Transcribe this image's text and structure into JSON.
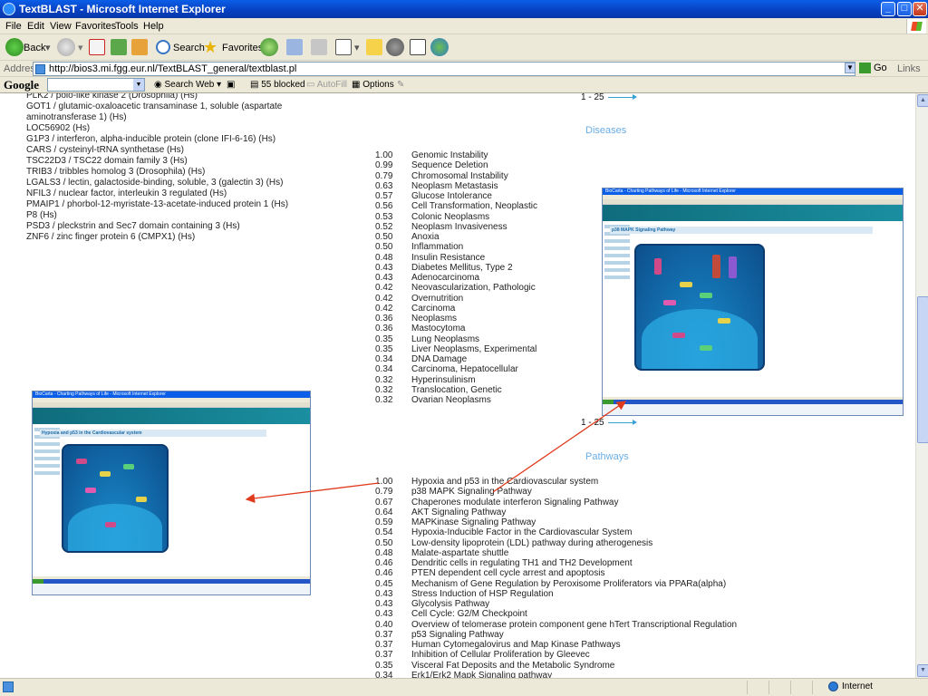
{
  "window": {
    "title": "TextBLAST - Microsoft Internet Explorer",
    "min": "_",
    "max": "□",
    "close": "✕"
  },
  "menu": [
    "File",
    "Edit",
    "View",
    "Favorites",
    "Tools",
    "Help"
  ],
  "toolbar": {
    "back": "Back",
    "search": "Search",
    "favorites": "Favorites"
  },
  "address": {
    "label": "Address",
    "url": "http://bios3.mi.fgg.eur.nl/TextBLAST_general/textblast.pl",
    "go": "Go",
    "links": "Links"
  },
  "google": {
    "logo": "Google",
    "search_web": "Search Web",
    "blocked": "55 blocked",
    "autofill": "AutoFill",
    "options": "Options"
  },
  "genes": [
    "PLK2 / polo-like kinase 2 (Drosophila) (Hs)",
    "GOT1 / glutamic-oxaloacetic transaminase 1, soluble (aspartate",
    "aminotransferase 1) (Hs)",
    "LOC56902 (Hs)",
    "G1P3 / interferon, alpha-inducible protein (clone IFI-6-16) (Hs)",
    "CARS / cysteinyl-tRNA synthetase (Hs)",
    "TSC22D3 / TSC22 domain family 3 (Hs)",
    "TRIB3 / tribbles homolog 3 (Drosophila) (Hs)",
    "LGALS3 / lectin, galactoside-binding, soluble, 3 (galectin 3) (Hs)",
    "NFIL3 / nuclear factor, interleukin 3 regulated (Hs)",
    "PMAIP1 / phorbol-12-myristate-13-acetate-induced protein 1 (Hs)",
    "P8 (Hs)",
    "PSD3 / pleckstrin and Sec7 domain containing 3 (Hs)",
    "ZNF6 / zinc finger protein 6 (CMPX1) (Hs)"
  ],
  "diseases": {
    "pager": "1 - 25",
    "title": "Diseases",
    "rows": [
      {
        "score": "1.00",
        "name": "Genomic Instability"
      },
      {
        "score": "0.99",
        "name": "Sequence Deletion"
      },
      {
        "score": "0.79",
        "name": "Chromosomal Instability"
      },
      {
        "score": "0.63",
        "name": "Neoplasm Metastasis"
      },
      {
        "score": "0.57",
        "name": "Glucose Intolerance"
      },
      {
        "score": "0.56",
        "name": "Cell Transformation, Neoplastic"
      },
      {
        "score": "0.53",
        "name": "Colonic Neoplasms"
      },
      {
        "score": "0.52",
        "name": "Neoplasm Invasiveness"
      },
      {
        "score": "0.50",
        "name": "Anoxia"
      },
      {
        "score": "0.50",
        "name": "Inflammation"
      },
      {
        "score": "0.48",
        "name": "Insulin Resistance"
      },
      {
        "score": "0.43",
        "name": "Diabetes Mellitus, Type 2"
      },
      {
        "score": "0.43",
        "name": "Adenocarcinoma"
      },
      {
        "score": "0.42",
        "name": "Neovascularization, Pathologic"
      },
      {
        "score": "0.42",
        "name": "Overnutrition"
      },
      {
        "score": "0.42",
        "name": "Carcinoma"
      },
      {
        "score": "0.36",
        "name": "Neoplasms"
      },
      {
        "score": "0.36",
        "name": "Mastocytoma"
      },
      {
        "score": "0.35",
        "name": "Lung Neoplasms"
      },
      {
        "score": "0.35",
        "name": "Liver Neoplasms, Experimental"
      },
      {
        "score": "0.34",
        "name": "DNA Damage"
      },
      {
        "score": "0.34",
        "name": "Carcinoma, Hepatocellular"
      },
      {
        "score": "0.32",
        "name": "Hyperinsulinism"
      },
      {
        "score": "0.32",
        "name": "Translocation, Genetic"
      },
      {
        "score": "0.32",
        "name": "Ovarian Neoplasms"
      }
    ]
  },
  "pathways": {
    "pager": "1 - 25",
    "title": "Pathways",
    "rows": [
      {
        "score": "1.00",
        "name": "Hypoxia and p53 in the Cardiovascular system"
      },
      {
        "score": "0.79",
        "name": "p38 MAPK Signaling Pathway"
      },
      {
        "score": "0.67",
        "name": "Chaperones modulate interferon Signaling Pathway"
      },
      {
        "score": "0.64",
        "name": "AKT Signaling Pathway"
      },
      {
        "score": "0.59",
        "name": "MAPKinase Signaling Pathway"
      },
      {
        "score": "0.54",
        "name": "Hypoxia-Inducible Factor in the Cardiovascular System"
      },
      {
        "score": "0.50",
        "name": "Low-density lipoprotein (LDL) pathway during atherogenesis"
      },
      {
        "score": "0.48",
        "name": "Malate-aspartate shuttle"
      },
      {
        "score": "0.46",
        "name": "Dendritic cells in regulating TH1 and TH2 Development"
      },
      {
        "score": "0.46",
        "name": "PTEN dependent cell cycle arrest and apoptosis"
      },
      {
        "score": "0.45",
        "name": "Mechanism of Gene Regulation by Peroxisome Proliferators via PPARa(alpha)"
      },
      {
        "score": "0.43",
        "name": "Stress Induction of HSP Regulation"
      },
      {
        "score": "0.43",
        "name": "Glycolysis Pathway"
      },
      {
        "score": "0.43",
        "name": "Cell Cycle: G2/M Checkpoint"
      },
      {
        "score": "0.40",
        "name": "Overview of telomerase protein component gene hTert Transcriptional Regulation"
      },
      {
        "score": "0.37",
        "name": "p53 Signaling Pathway"
      },
      {
        "score": "0.37",
        "name": "Human Cytomegalovirus and Map Kinase Pathways"
      },
      {
        "score": "0.37",
        "name": "Inhibition of Cellular Proliferation by Gleevec"
      },
      {
        "score": "0.35",
        "name": "Visceral Fat Deposits and the Metabolic Syndrome"
      },
      {
        "score": "0.34",
        "name": "Erk1/Erk2 Mapk Signaling pathway"
      }
    ]
  },
  "thumbnails": {
    "right_title": "BioCarta - Charting Pathways of Life - Microsoft Internet Explorer",
    "right_heading": "p38 MAPK Signaling Pathway",
    "left_title": "BioCarta - Charting Pathways of Life - Microsoft Internet Explorer",
    "left_heading": "Hypoxia and p53 in the Cardiovascular system"
  },
  "status": {
    "zone": "Internet"
  },
  "colors": {
    "accent": "#6aaee6",
    "arrow": "#e03a1c",
    "titlebar": "#0a5ee8"
  }
}
